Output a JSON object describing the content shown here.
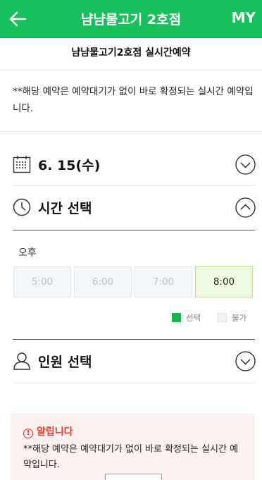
{
  "header": {
    "back_icon": "arrow-left-icon",
    "title": "냠냠물고기 2호점",
    "my_label": "MY",
    "background_color": "#16c05a"
  },
  "subheader": {
    "title": "냠냠물고기2호점 실시간예약"
  },
  "notice": {
    "text": "**해당 예약은 예약대기가 없이 바로 확정되는 실시간 예약입니다."
  },
  "date_section": {
    "icon": "calendar-icon",
    "label": "6. 15(수)",
    "toggle_icon": "chevron-down-circle-icon"
  },
  "time_section": {
    "icon": "clock-icon",
    "label": "시간 선택",
    "toggle_icon": "chevron-up-circle-icon",
    "period": "오후",
    "slots": [
      {
        "time": "5:00",
        "state": "unavailable"
      },
      {
        "time": "6:00",
        "state": "unavailable"
      },
      {
        "time": "7:00",
        "state": "unavailable"
      },
      {
        "time": "8:00",
        "state": "selected"
      }
    ],
    "legend": {
      "selected": "선택",
      "unavailable": "불가"
    },
    "selected_color": "#19b34a"
  },
  "people_section": {
    "icon": "person-icon",
    "label": "인원 선택",
    "toggle_icon": "chevron-down-circle-icon"
  },
  "alert": {
    "icon": "exclamation-circle-icon",
    "title": "알립니다",
    "text": "**해당 예약은 예약대기가 없이 바로 확정되는 실시간 예약입니다.",
    "color": "#e23b2e"
  }
}
